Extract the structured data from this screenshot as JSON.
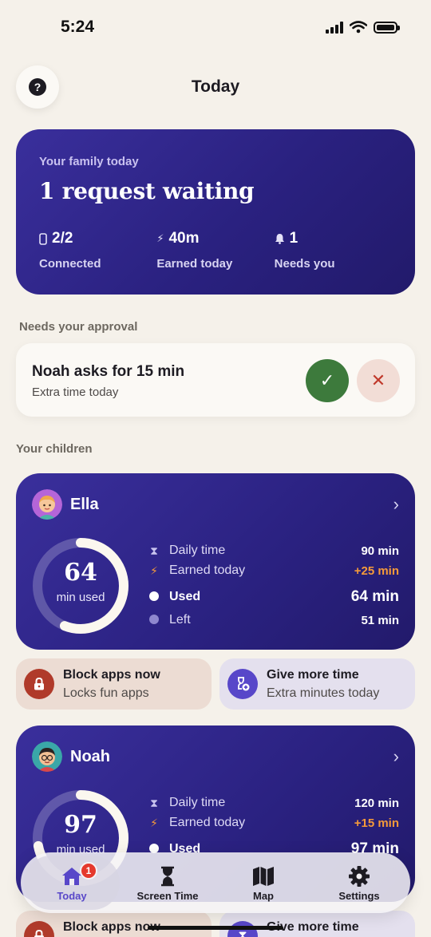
{
  "status_bar": {
    "time": "5:24"
  },
  "header": {
    "title": "Today",
    "help_glyph": "?"
  },
  "summary": {
    "kicker": "Your family today",
    "headline": "1 request waiting",
    "stats": [
      {
        "icon": "phone-icon",
        "value": "2/2",
        "label": "Connected"
      },
      {
        "icon": "bolt-icon",
        "value": "40m",
        "label": "Earned today"
      },
      {
        "icon": "bell-icon",
        "value": "1",
        "label": "Needs you"
      }
    ]
  },
  "approvals": {
    "section_label": "Needs your approval",
    "request": {
      "title": "Noah asks for 15 min",
      "subtitle": "Extra time today"
    }
  },
  "children_section": {
    "label": "Your children"
  },
  "children": [
    {
      "name": "Ella",
      "ring_value": "64",
      "ring_unit": "min used",
      "used_fraction": 0.56,
      "details": {
        "daily_label": "Daily time",
        "daily_value": "90 min",
        "earned_label": "Earned today",
        "earned_value": "+25 min",
        "used_label": "Used",
        "used_value": "64 min",
        "left_label": "Left",
        "left_value": "51 min"
      },
      "actions": {
        "block_title": "Block apps now",
        "block_sub": "Locks fun apps",
        "give_title": "Give more time",
        "give_sub": "Extra minutes today"
      }
    },
    {
      "name": "Noah",
      "ring_value": "97",
      "ring_unit": "min used",
      "used_fraction": 0.72,
      "details": {
        "daily_label": "Daily time",
        "daily_value": "120 min",
        "earned_label": "Earned today",
        "earned_value": "+15 min",
        "used_label": "Used",
        "used_value": "97 min"
      },
      "actions": {
        "block_title": "Block apps now",
        "give_title": "Give more time"
      }
    }
  ],
  "tab_bar": {
    "tabs": [
      {
        "label": "Today",
        "icon": "house-icon",
        "badge": "1"
      },
      {
        "label": "Screen Time",
        "icon": "hourglass-icon"
      },
      {
        "label": "Map",
        "icon": "map-icon"
      },
      {
        "label": "Settings",
        "icon": "gear-icon"
      }
    ]
  },
  "colors": {
    "card_primary": "#2a2180",
    "accent": "#5847c9",
    "approve": "#3d7a3c",
    "reject": "#c0392b",
    "earned": "#f59a3a",
    "badge": "#e5392d"
  }
}
